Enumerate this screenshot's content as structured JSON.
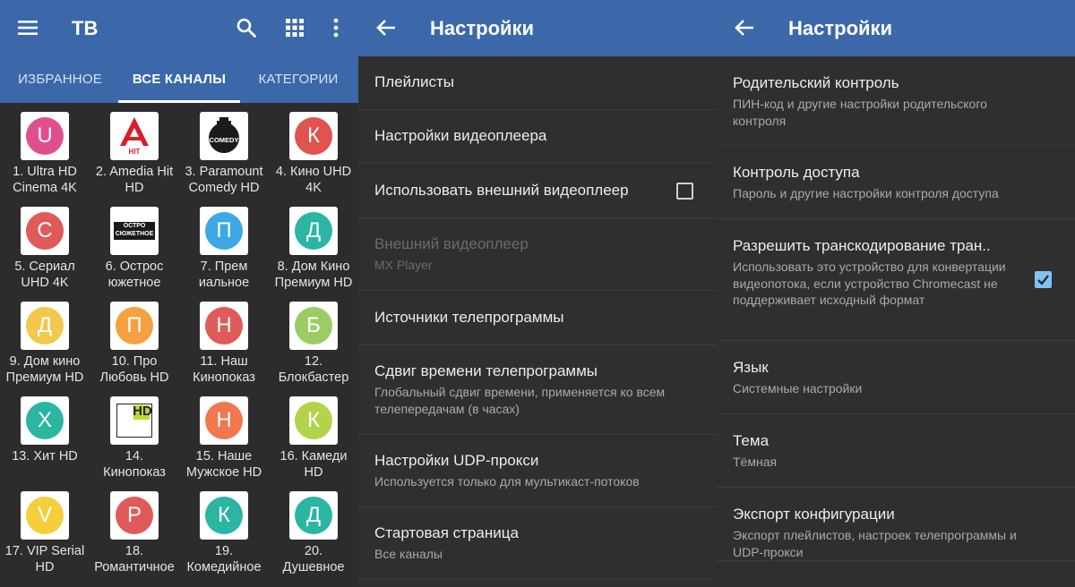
{
  "colors": {
    "appbar": "#3c68a9",
    "background": "#2c2c2c",
    "checkbox_checked": "#7fc3f1"
  },
  "panel1": {
    "title": "ТВ",
    "icons": [
      "menu-icon",
      "search-icon",
      "grid-icon",
      "more-vert-icon"
    ],
    "tabs": [
      {
        "label": "ИЗБРАННОЕ",
        "active": false
      },
      {
        "label": "ВСЕ КАНАЛЫ",
        "active": true
      },
      {
        "label": "КАТЕГОРИИ",
        "active": false
      }
    ],
    "channels": [
      {
        "name": "1. Ultra HD\nCinema 4K",
        "letter": "U",
        "color": "#e04f8d"
      },
      {
        "name": "2. Amedia Hit\nHD",
        "logo": "amedia-hit-logo",
        "logo_text": "HIT"
      },
      {
        "name": "3. Paramount\nComedy HD",
        "logo": "paramount-comedy-logo",
        "logo_text": "COMEDY"
      },
      {
        "name": "4. Кино UHD\n4K",
        "letter": "К",
        "color": "#e0534f"
      },
      {
        "name": "5. Сериал\nUHD 4K",
        "letter": "С",
        "color": "#e05a5a"
      },
      {
        "name": "6. Острос\nюжетное",
        "logo": "ostrosyuzhetnoe-logo",
        "logo_text": "ОСТРО\nСЮЖЕТНОЕ"
      },
      {
        "name": "7. Прем\nиальное",
        "letter": "П",
        "color": "#3ea7e6"
      },
      {
        "name": "8. Дом Кино\nПремиум HD",
        "letter": "Д",
        "color": "#2bb5a3"
      },
      {
        "name": "9. Дом кино\nПремиум HD",
        "letter": "Д",
        "color": "#f2c94c"
      },
      {
        "name": "10. Про\nЛюбовь HD",
        "letter": "П",
        "color": "#f5a142"
      },
      {
        "name": "11. Наш\nКинопоказ",
        "letter": "Н",
        "color": "#e05a5a"
      },
      {
        "name": "12.\nБлокбастер",
        "letter": "Б",
        "color": "#9ccc65"
      },
      {
        "name": "13. Хит HD",
        "letter": "Х",
        "color": "#2bb5a3"
      },
      {
        "name": "14.\nКинопоказ",
        "logo": "kinopokaz-logo",
        "logo_text": "HD"
      },
      {
        "name": "15. Наше\nМужское HD",
        "letter": "Н",
        "color": "#f0774f"
      },
      {
        "name": "16. Камеди\nHD",
        "letter": "К",
        "color": "#b3d34a"
      },
      {
        "name": "17. VIP Serial\nHD",
        "letter": "V",
        "color": "#f4cf3a"
      },
      {
        "name": "18.\nРомантичное",
        "letter": "Р",
        "color": "#e05a5a"
      },
      {
        "name": "19.\nКомедийное",
        "letter": "К",
        "color": "#2bb5a3"
      },
      {
        "name": "20.\nДушевное",
        "letter": "Д",
        "color": "#2bb5a3"
      }
    ]
  },
  "panel2": {
    "title": "Настройки",
    "rows": [
      {
        "title": "Плейлисты"
      },
      {
        "title": "Настройки видеоплеера"
      },
      {
        "title": "Использовать внешний видеоплеер",
        "checkbox": false
      },
      {
        "title": "Внешний видеоплеер",
        "subtitle": "MX Player",
        "disabled": true
      },
      {
        "title": "Источники телепрограммы"
      },
      {
        "title": "Сдвиг времени телепрограммы",
        "subtitle": "Глобальный сдвиг времени, применяется ко всем телепередачам (в часах)"
      },
      {
        "title": "Настройки UDP-прокси",
        "subtitle": "Используется только для мультикаст-потоков"
      },
      {
        "title": "Стартовая страница",
        "subtitle": "Все каналы"
      }
    ]
  },
  "panel3": {
    "title": "Настройки",
    "rows": [
      {
        "title": "Родительский контроль",
        "subtitle": "ПИН-код и другие настройки родительского контроля"
      },
      {
        "title": "Контроль доступа",
        "subtitle": "Пароль и другие настройки контроля доступа"
      },
      {
        "title": "Разрешить транскодирование тран..",
        "subtitle": "Использовать это устройство для конвертации видеопотока, если устройство Chromecast не поддерживает исходный формат",
        "checkbox": true
      },
      {
        "title": "Язык",
        "subtitle": "Системные настройки"
      },
      {
        "title": "Тема",
        "subtitle": "Тёмная"
      },
      {
        "title": "Экспорт конфигурации",
        "subtitle": "Экспорт плейлистов, настроек телепрограммы и UDP-прокси"
      }
    ]
  }
}
